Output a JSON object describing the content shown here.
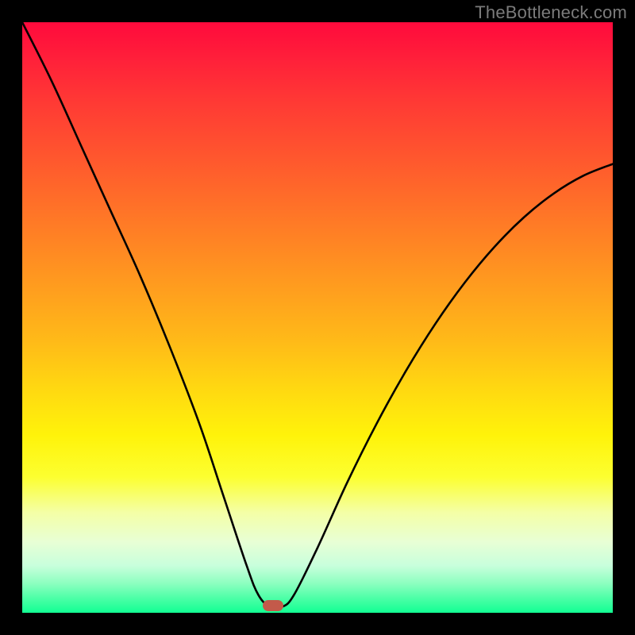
{
  "watermark": "TheBottleneck.com",
  "marker": {
    "x_pct": 42.5,
    "color": "#c35a4a"
  },
  "chart_data": {
    "type": "line",
    "title": "",
    "xlabel": "",
    "ylabel": "",
    "xlim": [
      0,
      100
    ],
    "ylim": [
      0,
      100
    ],
    "grid": false,
    "legend": false,
    "series": [
      {
        "name": "bottleneck-curve",
        "x": [
          0,
          5,
          10,
          15,
          20,
          25,
          30,
          34,
          38,
          40,
          42,
          44,
          46,
          50,
          55,
          60,
          65,
          70,
          75,
          80,
          85,
          90,
          95,
          100
        ],
        "values": [
          100,
          90,
          79,
          68,
          57,
          45,
          32,
          20,
          8,
          3,
          1,
          1,
          3,
          11,
          22,
          32,
          41,
          49,
          56,
          62,
          67,
          71,
          74,
          76
        ]
      }
    ],
    "annotations": [
      {
        "type": "marker",
        "x": 42.5,
        "y": 0.5,
        "shape": "pill",
        "color": "#c35a4a"
      }
    ],
    "background": {
      "type": "vertical-gradient",
      "stops": [
        {
          "pct": 0,
          "color": "#ff0a3c"
        },
        {
          "pct": 50,
          "color": "#ffba18"
        },
        {
          "pct": 78,
          "color": "#fcff30"
        },
        {
          "pct": 100,
          "color": "#12ff93"
        }
      ]
    }
  }
}
